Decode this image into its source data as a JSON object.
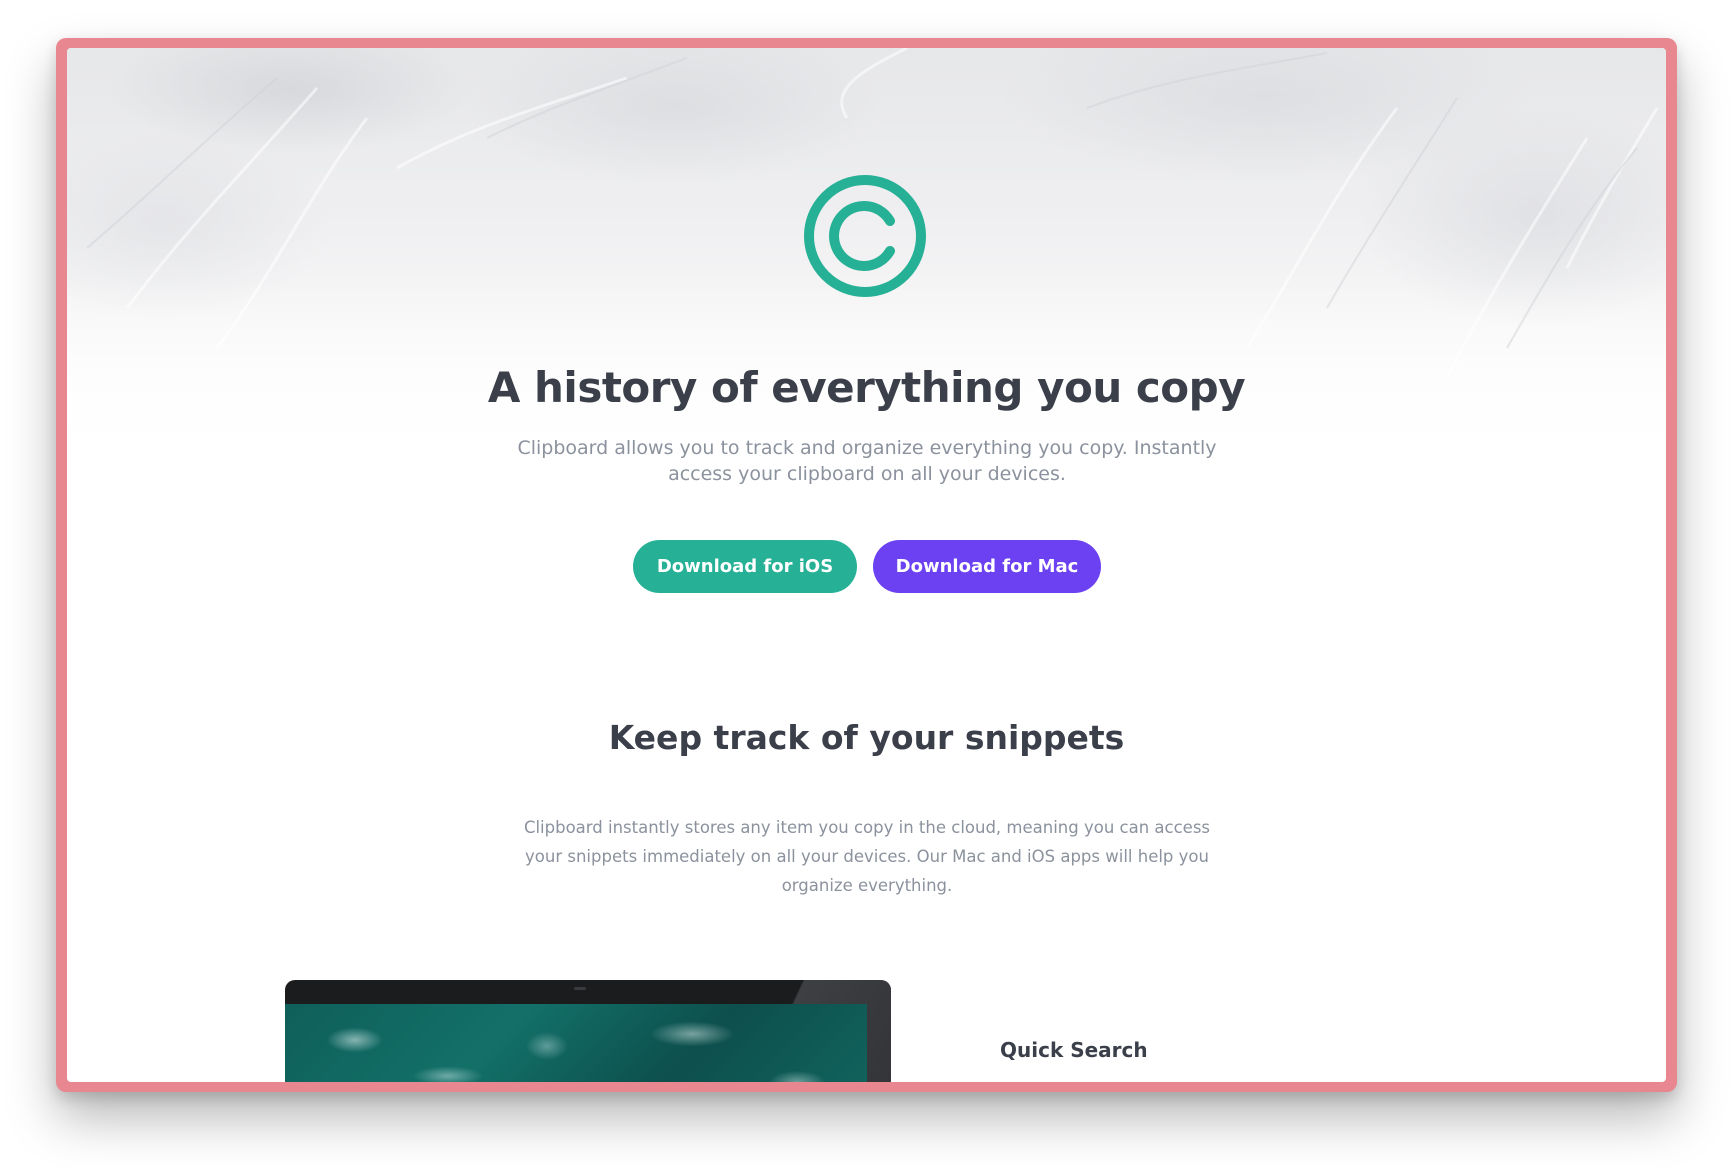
{
  "hero": {
    "logo_icon": "copyright-circle-icon",
    "headline": "A history of everything you copy",
    "subtext": "Clipboard allows you to track and organize everything you copy. Instantly access your clipboard on all your devices.",
    "buttons": {
      "ios_label": "Download for iOS",
      "mac_label": "Download for Mac"
    }
  },
  "snippets": {
    "title": "Keep track of your snippets",
    "text": "Clipboard instantly stores any item you copy in the cloud, meaning you can access your snippets immediately on all your devices. Our Mac and iOS apps will help you organize everything."
  },
  "features": {
    "first_title": "Quick Search"
  },
  "colors": {
    "frame": "#e8878f",
    "accent_green": "#26b196",
    "accent_purple": "#6c41f2",
    "heading": "#3a3f4a",
    "body_text": "#8b929d"
  }
}
